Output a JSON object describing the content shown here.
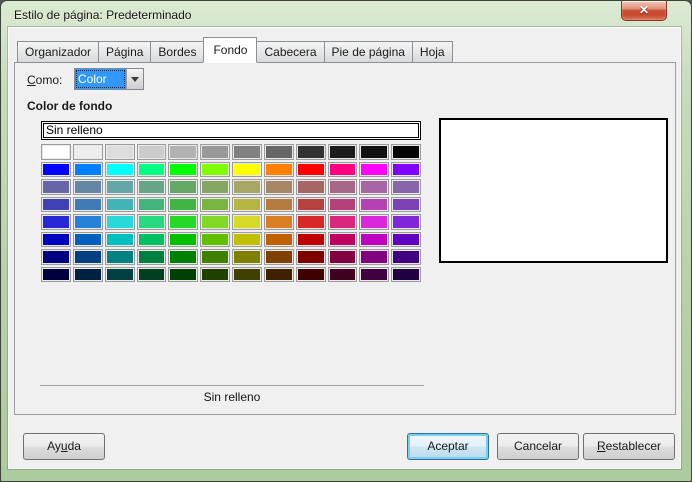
{
  "window": {
    "title": "Estilo de página: Predeterminado",
    "close_icon_glyph": "✕",
    "frame_color": "#b7d1aa",
    "titlebar_top_color": "#dcead4",
    "close_button_color": "#cc4e33"
  },
  "tabs": {
    "items": [
      "Organizador",
      "Página",
      "Bordes",
      "Fondo",
      "Cabecera",
      "Pie de página",
      "Hoja"
    ],
    "active": "Fondo"
  },
  "content": {
    "como": {
      "label": "Como:",
      "underline_index": 0
    },
    "como_value": "Color",
    "selection_highlight_color": "#3297fd",
    "section_title": "Color de fondo",
    "picker": {
      "none_option": "Sin relleno",
      "selected_option": "Sin relleno",
      "status_text": "Sin relleno",
      "columns": 12,
      "rows": 8,
      "palette_rows": [
        [
          "#FFFFFF",
          "#EEEEEE",
          "#DDDDDD",
          "#CCCCCC",
          "#B2B2B2",
          "#999999",
          "#808080",
          "#666666",
          "#333333",
          "#1C1C1C",
          "#111111",
          "#000000"
        ],
        [
          "#0000FF",
          "#0080FF",
          "#00FFFF",
          "#00FF80",
          "#00FF00",
          "#80FF00",
          "#FFFF00",
          "#FF8000",
          "#FF0000",
          "#FF0080",
          "#FF00FF",
          "#8000FF"
        ],
        [
          "#6666A6",
          "#6686A6",
          "#66A6A6",
          "#66A686",
          "#66A666",
          "#86A666",
          "#A6A666",
          "#A68666",
          "#A66666",
          "#A66686",
          "#A666A6",
          "#8666A6"
        ],
        [
          "#4141B5",
          "#417BB5",
          "#41B5B5",
          "#41B57B",
          "#41B541",
          "#7BB541",
          "#B5B541",
          "#B57B41",
          "#B54141",
          "#B5417B",
          "#B541B5",
          "#7B41B5"
        ],
        [
          "#2727D9",
          "#2780D9",
          "#27D9D9",
          "#27D980",
          "#27D927",
          "#80D927",
          "#D9D927",
          "#D98027",
          "#D92727",
          "#D92780",
          "#D927D9",
          "#8027D9"
        ],
        [
          "#0000C0",
          "#0060C0",
          "#00C0C0",
          "#00C060",
          "#00C000",
          "#60C000",
          "#C0C000",
          "#C06000",
          "#C00000",
          "#C00060",
          "#C000C0",
          "#6000C0"
        ],
        [
          "#000080",
          "#004080",
          "#008080",
          "#008040",
          "#008000",
          "#408000",
          "#808000",
          "#804000",
          "#800000",
          "#800040",
          "#800080",
          "#400080"
        ],
        [
          "#000040",
          "#002040",
          "#004040",
          "#004020",
          "#004000",
          "#204000",
          "#404000",
          "#402000",
          "#400000",
          "#400020",
          "#400040",
          "#200040"
        ]
      ]
    }
  },
  "buttons": {
    "help": {
      "label": "Ayuda",
      "underline_index": 2
    },
    "accept": {
      "label": "Aceptar",
      "underline_index": -1
    },
    "cancel": {
      "label": "Cancelar",
      "underline_index": -1
    },
    "reset": {
      "label": "Restablecer",
      "underline_index": 0
    }
  }
}
